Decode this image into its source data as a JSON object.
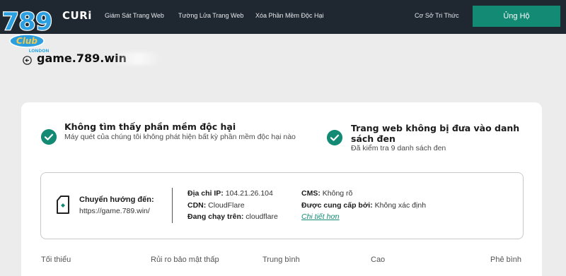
{
  "brand": {
    "logo_number": "789",
    "logo_word": "Club",
    "logo_sub": "LONDON",
    "product_suffix": "CURi"
  },
  "nav": {
    "items": [
      "Giám Sát Trang Web",
      "Tường Lửa Trang Web",
      "Xóa Phần Mềm Độc Hại"
    ],
    "knowledge": "Cơ Sở Tri Thức",
    "donate": "Ủng Hộ"
  },
  "site": {
    "domain": "game.789.win"
  },
  "results": [
    {
      "title": "Không tìm thấy phần mềm độc hại",
      "description": "Máy quét của chúng tôi không phát hiện bất kỳ phần mềm độc hại nào"
    },
    {
      "title": "Trang web không bị đưa vào danh sách đen",
      "description": "Đã kiểm tra 9 danh sách đen"
    }
  ],
  "info": {
    "redirect_label": "Chuyển hướng đến:",
    "redirect_value": "https://game.789.win/",
    "ip_label": "Địa chỉ IP:",
    "ip_value": "104.21.26.104",
    "cdn_label": "CDN:",
    "cdn_value": "CloudFlare",
    "running_label": "Đang chạy trên:",
    "running_value": "cloudflare",
    "cms_label": "CMS:",
    "cms_value": "Không rõ",
    "host_label": "Được cung cấp bởi:",
    "host_value": "Không xác định",
    "details_link": "Chi tiết hơn"
  },
  "risk_scale": [
    "Tối thiểu",
    "Rủi ro bảo mật thấp",
    "Trung bình",
    "Cao",
    "Phê bình"
  ],
  "colors": {
    "topbar": "#1f2730",
    "accent": "#138a74",
    "background": "#ececec",
    "logo_primary": "#2b9fe0",
    "logo_secondary": "#f2c94c"
  }
}
